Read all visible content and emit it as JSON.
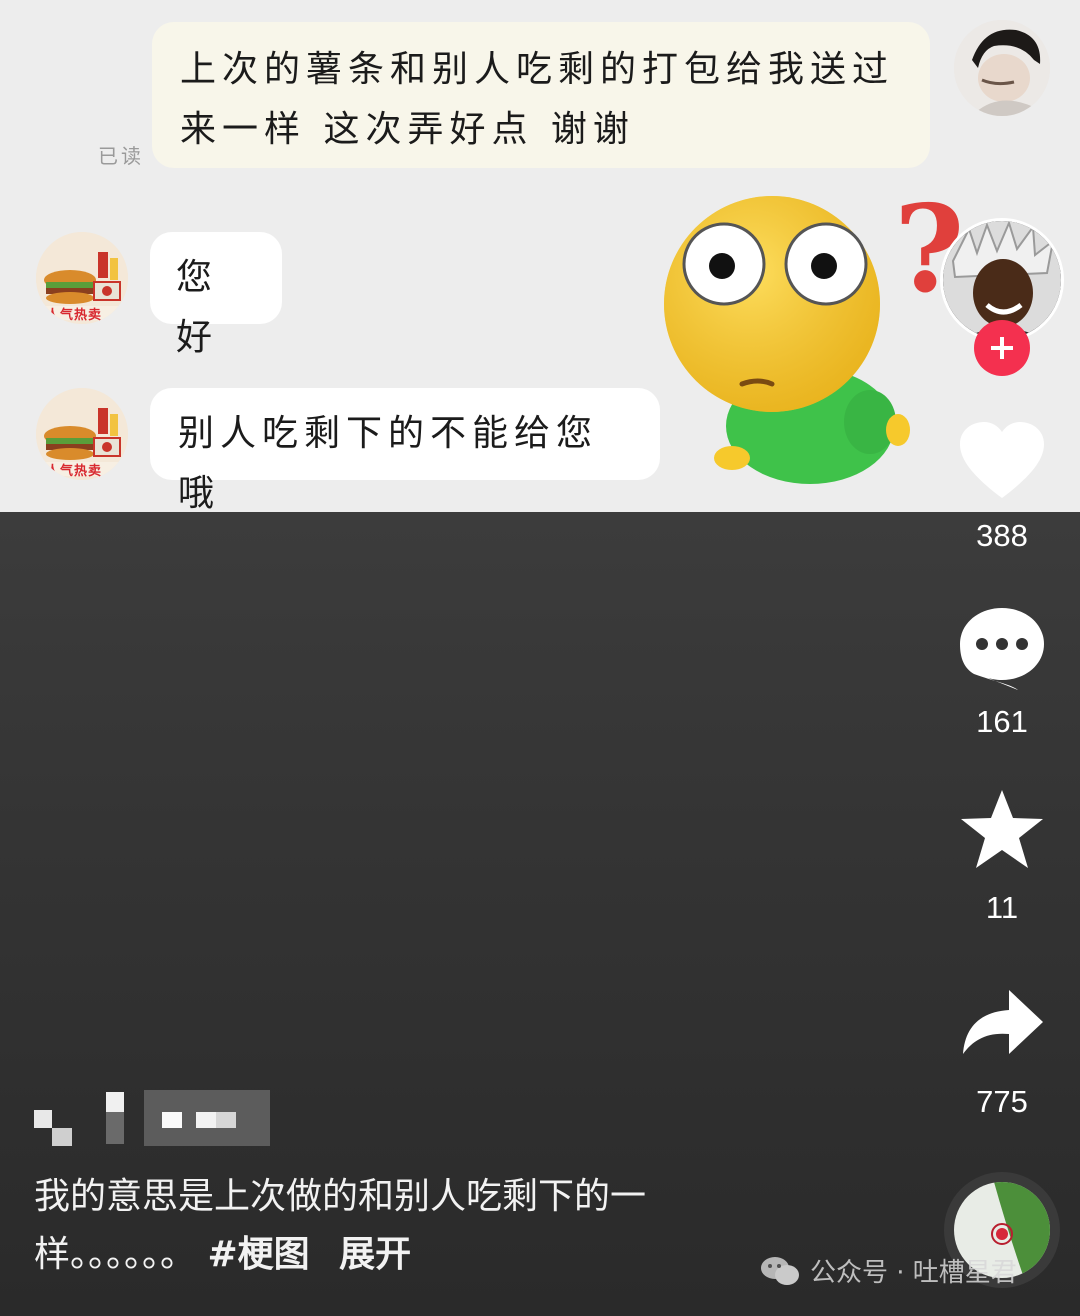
{
  "chat": {
    "my_message": "上次的薯条和别人吃剩的打包给我送过来一样 这次弄好点 谢谢",
    "read_status": "已读",
    "shop_messages": [
      "您好",
      "别人吃剩下的不能给您哦"
    ],
    "shop_avatar_label": "人气热卖"
  },
  "overlay": {
    "question_mark": "?"
  },
  "actions": {
    "follow_icon": "plus-icon",
    "like_count": "388",
    "comment_count": "161",
    "favorite_count": "11",
    "share_count": "775"
  },
  "caption": {
    "text": "我的意思是上次做的和别人吃剩下的一样。。。。。。",
    "hashtag": "#梗图",
    "expand": "展开"
  },
  "watermark": {
    "source": "公众号 · 吐槽星君"
  },
  "colors": {
    "accent_red": "#f4304f",
    "emoji_yellow": "#f6c92c",
    "emoji_green": "#3fc24a",
    "question_red": "#e0403c"
  }
}
